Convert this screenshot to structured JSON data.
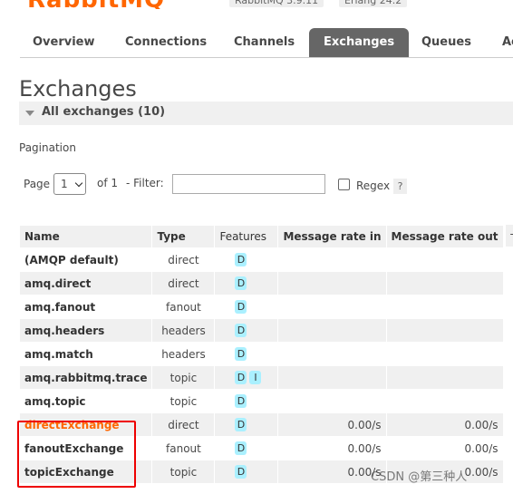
{
  "header": {
    "logo_text": "RabbitMQ",
    "version_badge": "RabbitMQ 3.9.11",
    "erlang_badge": "Erlang 24.2"
  },
  "nav": {
    "tabs": [
      {
        "label": "Overview",
        "active": false
      },
      {
        "label": "Connections",
        "active": false
      },
      {
        "label": "Channels",
        "active": false
      },
      {
        "label": "Exchanges",
        "active": true
      },
      {
        "label": "Queues",
        "active": false
      },
      {
        "label": "Ac",
        "active": false
      }
    ]
  },
  "page": {
    "title": "Exchanges",
    "section_title": "All exchanges (10)"
  },
  "pagination": {
    "label": "Pagination",
    "page_label": "Page",
    "page_value": "1",
    "of_label": "of 1",
    "filter_label": "- Filter:",
    "filter_value": "",
    "regex_label": "Regex",
    "help_label": "?"
  },
  "table": {
    "headers": [
      "Name",
      "Type",
      "Features",
      "Message rate in",
      "Message rate out"
    ],
    "plus_minus": "+/-",
    "rows": [
      {
        "name": "(AMQP default)",
        "type": "direct",
        "features": [
          "D"
        ],
        "rate_in": "",
        "rate_out": ""
      },
      {
        "name": "amq.direct",
        "type": "direct",
        "features": [
          "D"
        ],
        "rate_in": "",
        "rate_out": ""
      },
      {
        "name": "amq.fanout",
        "type": "fanout",
        "features": [
          "D"
        ],
        "rate_in": "",
        "rate_out": ""
      },
      {
        "name": "amq.headers",
        "type": "headers",
        "features": [
          "D"
        ],
        "rate_in": "",
        "rate_out": ""
      },
      {
        "name": "amq.match",
        "type": "headers",
        "features": [
          "D"
        ],
        "rate_in": "",
        "rate_out": ""
      },
      {
        "name": "amq.rabbitmq.trace",
        "type": "topic",
        "features": [
          "D",
          "I"
        ],
        "rate_in": "",
        "rate_out": ""
      },
      {
        "name": "amq.topic",
        "type": "topic",
        "features": [
          "D"
        ],
        "rate_in": "",
        "rate_out": ""
      },
      {
        "name": "directExchange",
        "type": "direct",
        "features": [
          "D"
        ],
        "rate_in": "0.00/s",
        "rate_out": "0.00/s"
      },
      {
        "name": "fanoutExchange",
        "type": "fanout",
        "features": [
          "D"
        ],
        "rate_in": "0.00/s",
        "rate_out": "0.00/s"
      },
      {
        "name": "topicExchange",
        "type": "topic",
        "features": [
          "D"
        ],
        "rate_in": "0.00/s",
        "rate_out": "0.00/s"
      }
    ]
  },
  "watermark": "CSDN @第三种人",
  "colors": {
    "accent": "#ff6600",
    "badge": "#aaf0ff",
    "active_tab": "#666666",
    "highlight_box": "#ee0000"
  }
}
